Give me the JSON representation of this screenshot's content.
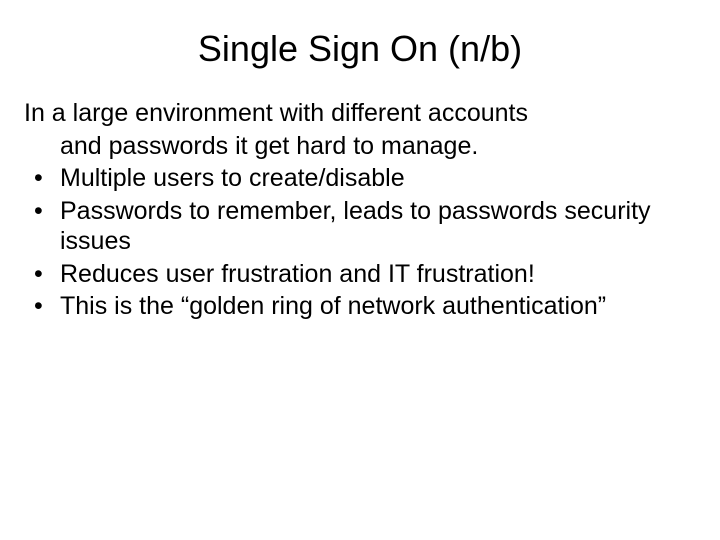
{
  "slide": {
    "title": "Single Sign On (n/b)",
    "intro_line1": "In a large environment with different accounts",
    "intro_line2": "and passwords it get hard to manage.",
    "bullets": [
      "Multiple users to create/disable",
      "Passwords to remember, leads to passwords security issues",
      "Reduces user frustration and IT frustration!",
      "This is the “golden ring of network authentication”"
    ]
  }
}
